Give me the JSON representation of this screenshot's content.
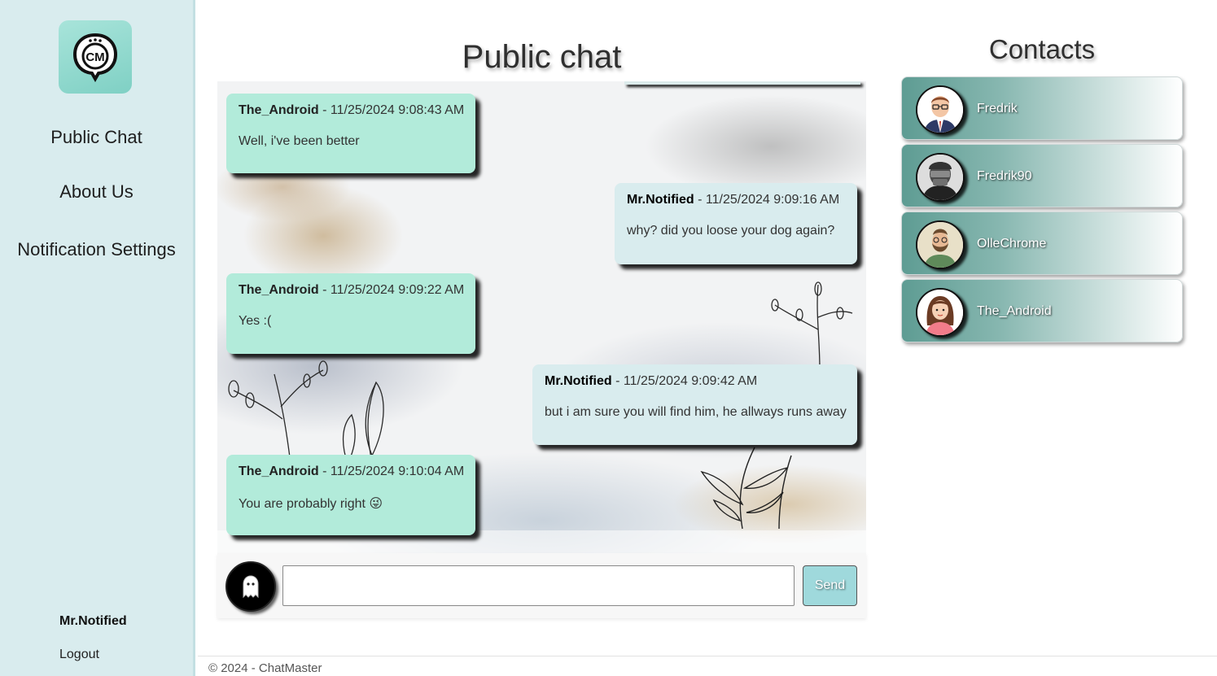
{
  "sidebar": {
    "logo_icon": "chatmaster-logo-icon",
    "nav": {
      "public_chat": "Public Chat",
      "about_us": "About Us",
      "notification_settings": "Notification Settings"
    },
    "user": {
      "name": "Mr.Notified",
      "logout": "Logout"
    }
  },
  "chat": {
    "title": "Public chat",
    "messages": [
      {
        "author": "The_Android",
        "time": " - 11/25/2024 9:08:43 AM",
        "text": "Well, i've been better",
        "side": "left"
      },
      {
        "author": "Mr.Notified",
        "time": " - 11/25/2024 9:09:16 AM",
        "text": "why? did you loose your dog again?",
        "side": "right"
      },
      {
        "author": "The_Android",
        "time": " - 11/25/2024 9:09:22 AM",
        "text": "Yes :(",
        "side": "left"
      },
      {
        "author": "Mr.Notified",
        "time": " - 11/25/2024 9:09:42 AM",
        "text": "but i am sure you will find him, he allways runs away",
        "side": "right"
      },
      {
        "author": "The_Android",
        "time": " - 11/25/2024 9:10:04 AM",
        "text": "You are probably right 😜",
        "side": "left"
      }
    ],
    "input": {
      "value": "",
      "placeholder": "",
      "send_label": "Send"
    },
    "colors": {
      "them_bubble": "#b2ebda",
      "me_bubble": "#d9ecee"
    }
  },
  "contacts": {
    "title": "Contacts",
    "items": [
      {
        "name": "Fredrik",
        "avatar": "man-with-glasses-suit-avatar"
      },
      {
        "name": "Fredrik90",
        "avatar": "masked-villain-avatar"
      },
      {
        "name": "OlleChrome",
        "avatar": "bearded-man-glasses-avatar"
      },
      {
        "name": "The_Android",
        "avatar": "woman-long-hair-avatar"
      }
    ]
  },
  "footer": {
    "text": "© 2024 - ChatMaster"
  }
}
